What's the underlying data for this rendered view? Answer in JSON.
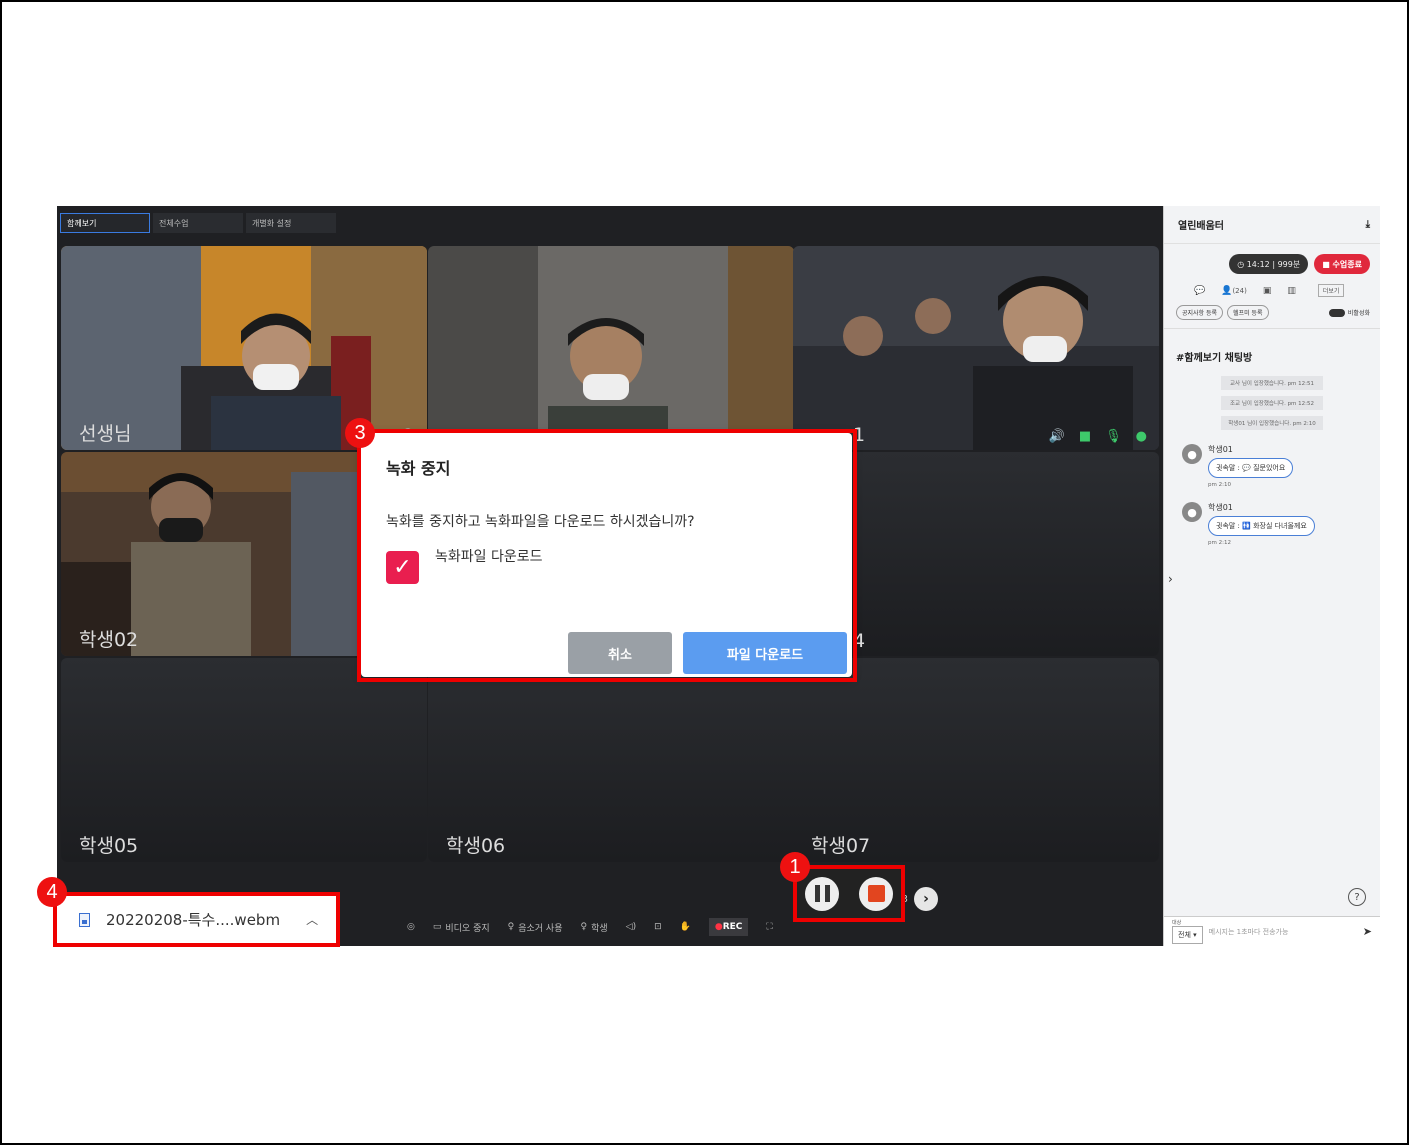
{
  "tabs": [
    "함께보기",
    "전체수업",
    "개별화 설정"
  ],
  "tiles": [
    {
      "name": "선생님"
    },
    {
      "name": ""
    },
    {
      "name": "1"
    },
    {
      "name": "학생02"
    },
    {
      "name": ""
    },
    {
      "name": "4"
    },
    {
      "name": "학생05"
    },
    {
      "name": "학생06"
    },
    {
      "name": "학생07"
    }
  ],
  "pager": {
    "text": "1 / 3"
  },
  "toolbar": {
    "video_stop": "비디오 중지",
    "sound_use": "음소거 사용",
    "student": "학생",
    "rec": "REC"
  },
  "sidebar": {
    "title": "열린배움터",
    "timer": "14:12",
    "count": "999분",
    "end_class": "수업종료",
    "participants": "(24)",
    "more": "더보기",
    "notice_btn": "공지사항 등록",
    "help_btn": "헬프미 등록",
    "toggle_label": "비활성화",
    "chat_title": "#함께보기 채팅방",
    "system_msgs": [
      "교사 님이 입장했습니다. pm 12:51",
      "조교 님이 입장했습니다. pm 12:52",
      "학생01 님이 입장했습니다. pm 2:10"
    ],
    "messages": [
      {
        "who": "학생01",
        "text": "귓속말 : 💬 질문있어요",
        "time": "pm 2:10"
      },
      {
        "who": "학생01",
        "text": "귓속말 : 🚻 화장실 다녀올께요",
        "time": "pm 2:12"
      }
    ],
    "target_label": "대상",
    "target_value": "전체",
    "input_placeholder": "메시지는 1초마다 전송가능"
  },
  "modal": {
    "title": "녹화 중지",
    "message": "녹화를 중지하고 녹화파일을 다운로드 하시겠습니까?",
    "checkbox_label": "녹화파일 다운로드",
    "checkbox_checked": true,
    "cancel": "취소",
    "download": "파일 다운로드"
  },
  "download_bar": {
    "filename": "20220208-특수....webm"
  },
  "badges": [
    "1",
    "3",
    "4"
  ],
  "colors": {
    "highlight": "#ee0000",
    "checkbox": "#e91e4f",
    "primary": "#5b9cf0",
    "end_class": "#e0283c"
  }
}
